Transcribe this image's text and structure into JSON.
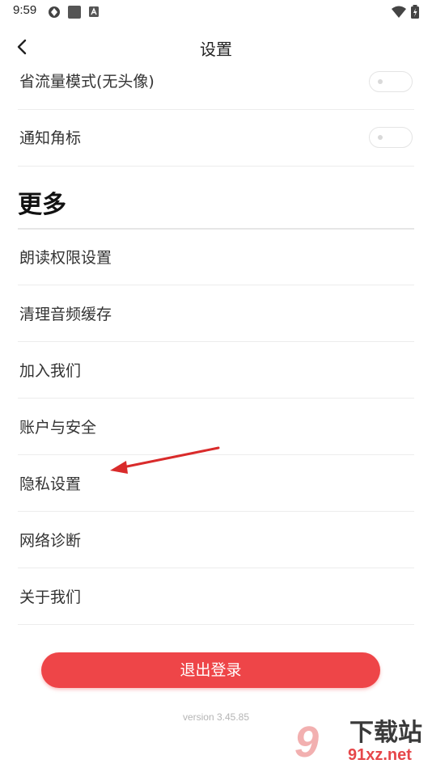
{
  "status_bar": {
    "time": "9:59"
  },
  "header": {
    "title": "设置"
  },
  "settings_toggles": [
    {
      "label": "省流量模式(无头像)",
      "on": false
    },
    {
      "label": "通知角标",
      "on": false
    }
  ],
  "more_section": {
    "title": "更多",
    "items": [
      {
        "label": "朗读权限设置"
      },
      {
        "label": "清理音频缓存"
      },
      {
        "label": "加入我们"
      },
      {
        "label": "账户与安全"
      },
      {
        "label": "隐私设置"
      },
      {
        "label": "网络诊断"
      },
      {
        "label": "关于我们"
      }
    ]
  },
  "logout_button": {
    "label": "退出登录"
  },
  "version_text": "version 3.45.85",
  "watermark": {
    "big": "9",
    "text": "下载站",
    "url": "91xz.net"
  },
  "colors": {
    "accent": "#ee4548",
    "annotation_arrow": "#d92b2b"
  },
  "icons": {
    "back": "chevron-left-icon",
    "status": [
      "app-notification-icon",
      "square-icon",
      "a-icon",
      "wifi-icon",
      "battery-icon"
    ]
  }
}
